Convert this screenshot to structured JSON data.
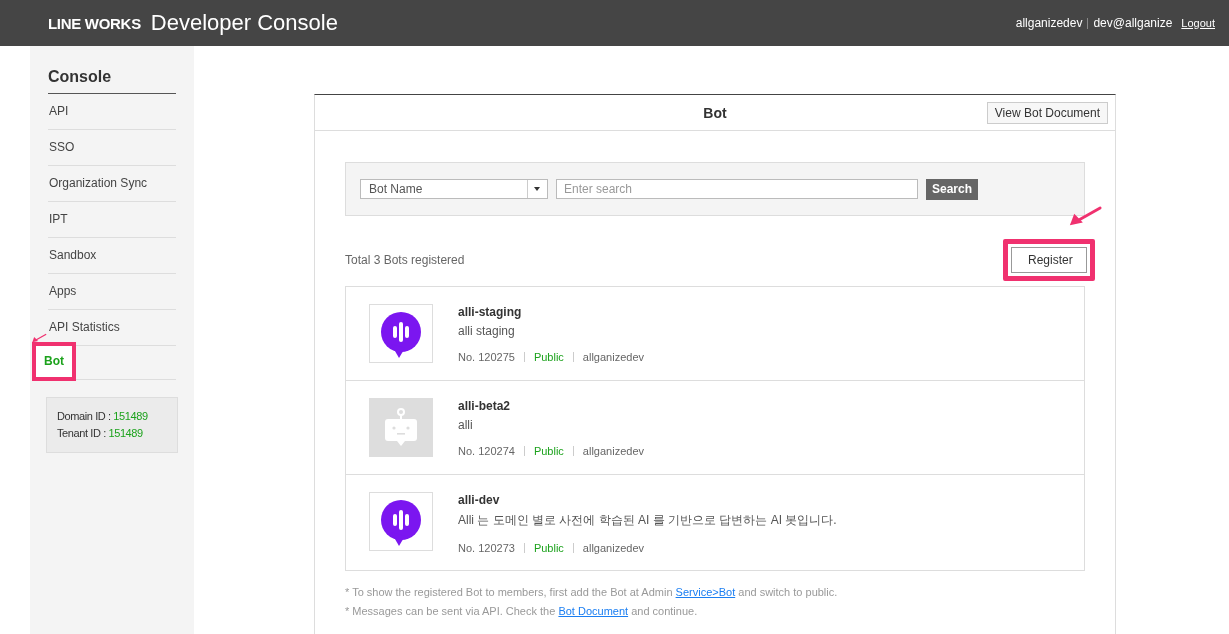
{
  "header": {
    "logo": "LINE WORKS",
    "title": "Developer Console",
    "user": "allganizedev",
    "email": "dev@allganize",
    "logout": "Logout"
  },
  "sidebar": {
    "title": "Console",
    "items": [
      {
        "label": "API",
        "selected": false,
        "annotated": false
      },
      {
        "label": "SSO",
        "selected": false,
        "annotated": false
      },
      {
        "label": "Organization Sync",
        "selected": false,
        "annotated": false
      },
      {
        "label": "IPT",
        "selected": false,
        "annotated": false
      },
      {
        "label": "Sandbox",
        "selected": false,
        "annotated": false
      },
      {
        "label": "Apps",
        "selected": false,
        "annotated": false
      },
      {
        "label": "API Statistics",
        "selected": false,
        "annotated": false
      },
      {
        "label": "Bot",
        "selected": true,
        "annotated": true
      }
    ],
    "ids": [
      {
        "label": "Domain ID : ",
        "value": "151489"
      },
      {
        "label": "Tenant ID : ",
        "value": "151489"
      }
    ]
  },
  "panel": {
    "title": "Bot",
    "doc_button": "View Bot Document",
    "search": {
      "filter": "Bot Name",
      "placeholder": "Enter search",
      "button": "Search"
    },
    "total": "Total 3 Bots registered",
    "register": {
      "label": "Register",
      "annotated": true
    },
    "bots": [
      {
        "name": "alli-staging",
        "description": "alli staging",
        "number": "No. 120275",
        "status": "Public",
        "owner": "allganizedev",
        "kind": "alli"
      },
      {
        "name": "alli-beta2",
        "description": "alli",
        "number": "No. 120274",
        "status": "Public",
        "owner": "allganizedev",
        "kind": "default"
      },
      {
        "name": "alli-dev",
        "description": "Alli 는 도메인 별로 사전에 학습된 AI 를 기반으로 답변하는 AI 봇입니다.",
        "number": "No. 120273",
        "status": "Public",
        "owner": "allganizedev",
        "kind": "alli"
      }
    ],
    "notes": [
      {
        "before": "* To show the registered Bot to members, first add the Bot at Admin ",
        "link": "Service>Bot",
        "after": " and switch to public."
      },
      {
        "before": "* Messages can be sent via API. Check the ",
        "link": "Bot Document",
        "after": " and continue."
      }
    ]
  }
}
